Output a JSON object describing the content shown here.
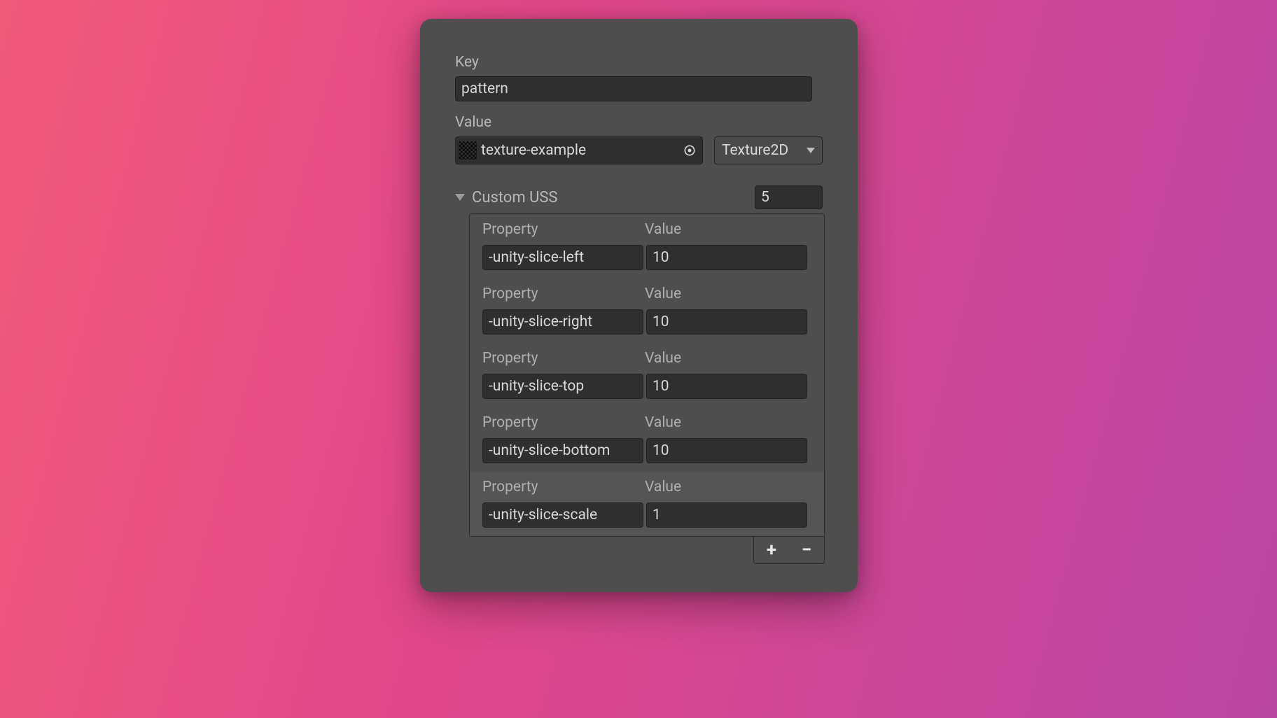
{
  "key": {
    "label": "Key",
    "value": "pattern"
  },
  "value": {
    "label": "Value",
    "object_name": "texture-example",
    "type_selected": "Texture2D"
  },
  "custom_uss": {
    "title": "Custom USS",
    "count": "5",
    "property_header": "Property",
    "value_header": "Value",
    "items": [
      {
        "property": "-unity-slice-left",
        "value": "10"
      },
      {
        "property": "-unity-slice-right",
        "value": "10"
      },
      {
        "property": "-unity-slice-top",
        "value": "10"
      },
      {
        "property": "-unity-slice-bottom",
        "value": "10"
      },
      {
        "property": "-unity-slice-scale",
        "value": "1"
      }
    ],
    "add_label": "+",
    "remove_label": "−"
  }
}
